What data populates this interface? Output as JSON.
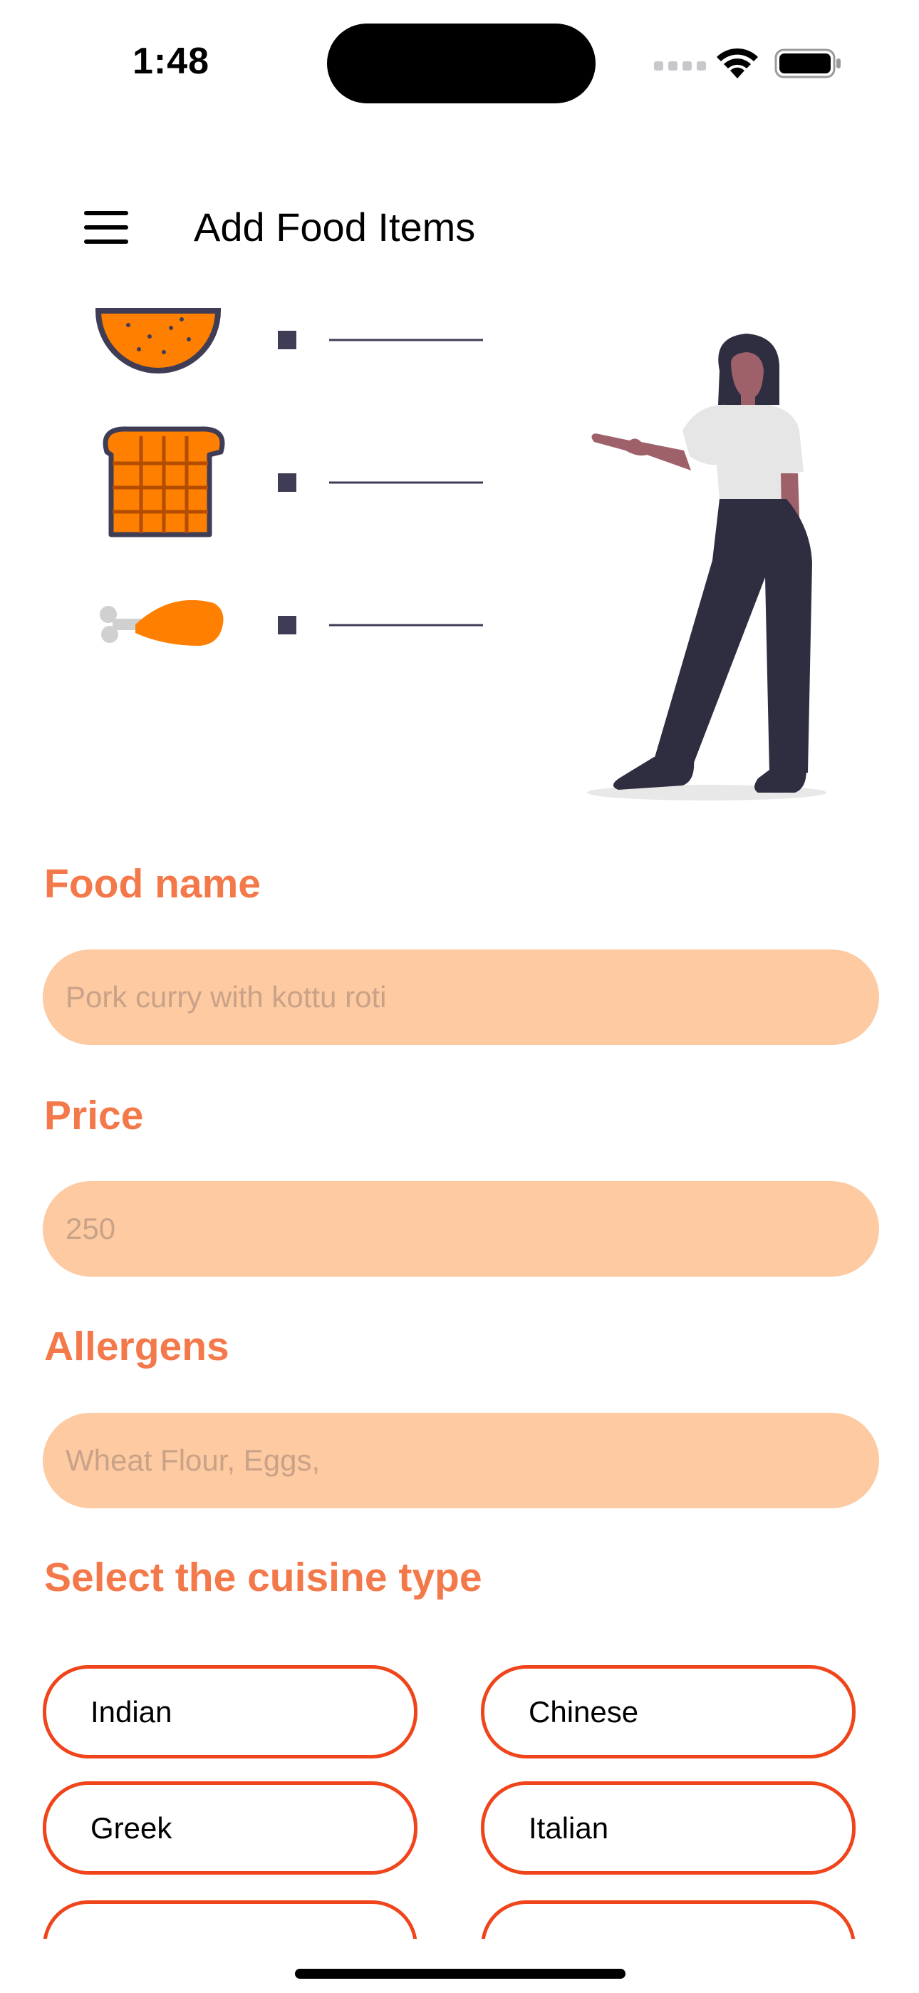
{
  "status_bar": {
    "time": "1:48"
  },
  "header": {
    "title": "Add Food Items"
  },
  "colors": {
    "accent": "#f4794a",
    "field_bg": "#fdcaa2",
    "chip_border": "#f0441b",
    "illustration_orange": "#ff7f00"
  },
  "form": {
    "food_name": {
      "label": "Food name",
      "placeholder": "Pork curry with kottu roti"
    },
    "price": {
      "label": "Price",
      "placeholder": "250"
    },
    "allergens": {
      "label": "Allergens",
      "placeholder": "Wheat Flour, Eggs,"
    },
    "cuisine": {
      "label": "Select the cuisine type",
      "options": [
        "Indian",
        "Chinese",
        "Greek",
        "Italian"
      ]
    }
  },
  "icons": [
    "menu-icon",
    "wifi-icon",
    "battery-icon",
    "cellular-signal-icon"
  ]
}
